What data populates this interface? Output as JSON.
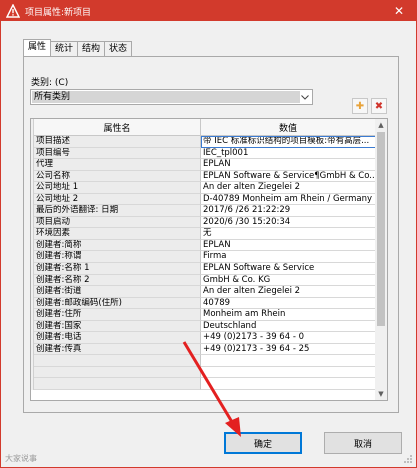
{
  "window": {
    "title": "项目属性:新项目",
    "close_glyph": "✕"
  },
  "tabs": [
    {
      "label": "属性",
      "active": true
    },
    {
      "label": "统计",
      "active": false
    },
    {
      "label": "结构",
      "active": false
    },
    {
      "label": "状态",
      "active": false
    }
  ],
  "category": {
    "label": "类别: (C)",
    "value": "所有类别"
  },
  "toolbar": {
    "add_glyph": "✚",
    "delete_glyph": "✖"
  },
  "grid": {
    "headers": [
      "属性名",
      "数值"
    ],
    "rows": [
      {
        "name": "项目描述",
        "value": "带 IEC 标准标识结构的项目模板:带有高层..."
      },
      {
        "name": "项目编号",
        "value": "IEC_tpl001"
      },
      {
        "name": "代理",
        "value": "EPLAN"
      },
      {
        "name": "公司名称",
        "value": "EPLAN Software & Service¶GmbH & Co..."
      },
      {
        "name": "公司地址 1",
        "value": "An der alten Ziegelei 2"
      },
      {
        "name": "公司地址 2",
        "value": "D-40789 Monheim am Rhein / Germany"
      },
      {
        "name": "最后的外语翻译: 日期",
        "value": "2017/6 /26 21:22:29"
      },
      {
        "name": "项目启动",
        "value": "2020/6 /30 15:20:34"
      },
      {
        "name": "环境因素",
        "value": "无"
      },
      {
        "name": "创建者:简称",
        "value": "EPLAN"
      },
      {
        "name": "创建者:称谓",
        "value": "Firma"
      },
      {
        "name": "创建者:名称 1",
        "value": "EPLAN Software & Service"
      },
      {
        "name": "创建者:名称 2",
        "value": "GmbH & Co. KG"
      },
      {
        "name": "创建者:街道",
        "value": "An der alten Ziegelei 2"
      },
      {
        "name": "创建者:邮政编码(住所)",
        "value": "40789"
      },
      {
        "name": "创建者:住所",
        "value": "Monheim am Rhein"
      },
      {
        "name": "创建者:国家",
        "value": "Deutschland"
      },
      {
        "name": "创建者:电话",
        "value": "+49 (0)2173 - 39 64 - 0"
      },
      {
        "name": "创建者:传真",
        "value": "+49 (0)2173 - 39 64 - 25"
      },
      {
        "name": "",
        "value": ""
      },
      {
        "name": "",
        "value": ""
      },
      {
        "name": "",
        "value": ""
      }
    ]
  },
  "buttons": {
    "ok": "确定",
    "cancel": "取消"
  },
  "watermark": "大家说事"
}
